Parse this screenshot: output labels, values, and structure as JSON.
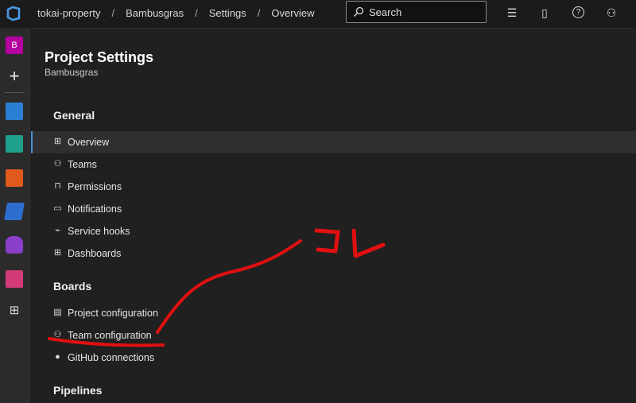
{
  "header": {
    "breadcrumbs": [
      "tokai-property",
      "Bambusgras",
      "Settings",
      "Overview"
    ],
    "separator": "/",
    "search_placeholder": "Search"
  },
  "rail": {
    "project_initial": "B",
    "project_color": "#b4009e"
  },
  "page": {
    "title": "Project Settings",
    "subtitle": "Bambusgras"
  },
  "sections": [
    {
      "title": "General",
      "items": [
        {
          "label": "Overview",
          "icon": "overview-icon",
          "selected": true
        },
        {
          "label": "Teams",
          "icon": "teams-icon"
        },
        {
          "label": "Permissions",
          "icon": "lock-icon"
        },
        {
          "label": "Notifications",
          "icon": "notification-icon"
        },
        {
          "label": "Service hooks",
          "icon": "plug-icon"
        },
        {
          "label": "Dashboards",
          "icon": "dashboard-icon"
        }
      ]
    },
    {
      "title": "Boards",
      "items": [
        {
          "label": "Project configuration",
          "icon": "project-config-icon"
        },
        {
          "label": "Team configuration",
          "icon": "team-config-icon"
        },
        {
          "label": "GitHub connections",
          "icon": "github-icon"
        }
      ]
    },
    {
      "title": "Pipelines",
      "items": []
    }
  ],
  "annotation": {
    "text": "コレ",
    "color": "#e01010"
  }
}
